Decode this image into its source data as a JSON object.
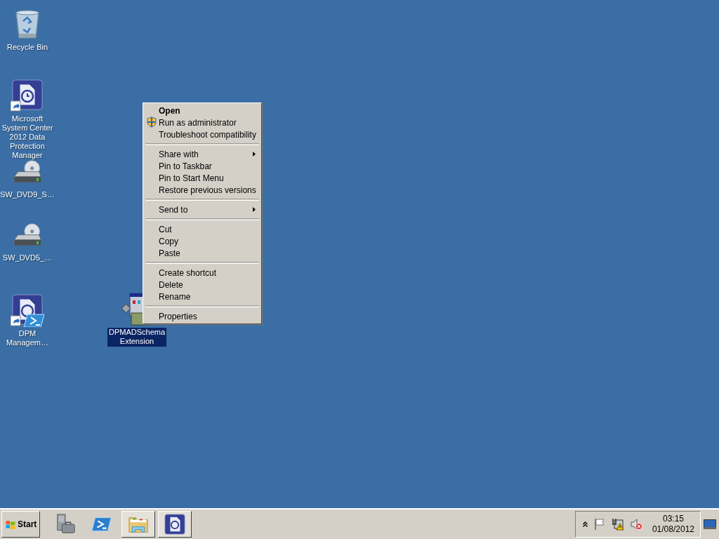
{
  "desktop_icons": [
    {
      "kind": "recycle-bin",
      "label": "Recycle Bin",
      "selected": false
    },
    {
      "kind": "dpm-shortcut",
      "label": "Microsoft System Center 2012 Data Protection Manager",
      "selected": false
    },
    {
      "kind": "dvd-drive",
      "label": "SW_DVD9_S…",
      "selected": false
    },
    {
      "kind": "dvd-drive",
      "label": "SW_DVD5_…",
      "selected": false
    },
    {
      "kind": "dpm-shell-shortcut",
      "label": "DPM Managem…",
      "selected": false
    },
    {
      "kind": "installer",
      "label": "DPMADSchema Extension",
      "selected": true
    }
  ],
  "context_menu": {
    "items": [
      {
        "kind": "item",
        "label": "Open",
        "default": true,
        "elevated": false,
        "submenu": false
      },
      {
        "kind": "item",
        "label": "Run as administrator",
        "default": false,
        "elevated": true,
        "submenu": false
      },
      {
        "kind": "item",
        "label": "Troubleshoot compatibility",
        "default": false,
        "elevated": false,
        "submenu": false
      },
      {
        "kind": "separator"
      },
      {
        "kind": "item",
        "label": "Share with",
        "default": false,
        "elevated": false,
        "submenu": true
      },
      {
        "kind": "item",
        "label": "Pin to Taskbar",
        "default": false,
        "elevated": false,
        "submenu": false
      },
      {
        "kind": "item",
        "label": "Pin to Start Menu",
        "default": false,
        "elevated": false,
        "submenu": false
      },
      {
        "kind": "item",
        "label": "Restore previous versions",
        "default": false,
        "elevated": false,
        "submenu": false
      },
      {
        "kind": "separator"
      },
      {
        "kind": "item",
        "label": "Send to",
        "default": false,
        "elevated": false,
        "submenu": true
      },
      {
        "kind": "separator"
      },
      {
        "kind": "item",
        "label": "Cut",
        "default": false,
        "elevated": false,
        "submenu": false
      },
      {
        "kind": "item",
        "label": "Copy",
        "default": false,
        "elevated": false,
        "submenu": false
      },
      {
        "kind": "item",
        "label": "Paste",
        "default": false,
        "elevated": false,
        "submenu": false
      },
      {
        "kind": "separator"
      },
      {
        "kind": "item",
        "label": "Create shortcut",
        "default": false,
        "elevated": false,
        "submenu": false
      },
      {
        "kind": "item",
        "label": "Delete",
        "default": false,
        "elevated": false,
        "submenu": false
      },
      {
        "kind": "item",
        "label": "Rename",
        "default": false,
        "elevated": false,
        "submenu": false
      },
      {
        "kind": "separator"
      },
      {
        "kind": "item",
        "label": "Properties",
        "default": false,
        "elevated": false,
        "submenu": false
      }
    ]
  },
  "taskbar": {
    "start_label": "Start",
    "buttons": [
      {
        "kind": "server-manager",
        "open": false
      },
      {
        "kind": "powershell",
        "open": false
      },
      {
        "kind": "explorer",
        "open": true
      },
      {
        "kind": "dpm",
        "open": true
      }
    ],
    "tray": {
      "time": "03:15",
      "date": "01/08/2012"
    }
  }
}
